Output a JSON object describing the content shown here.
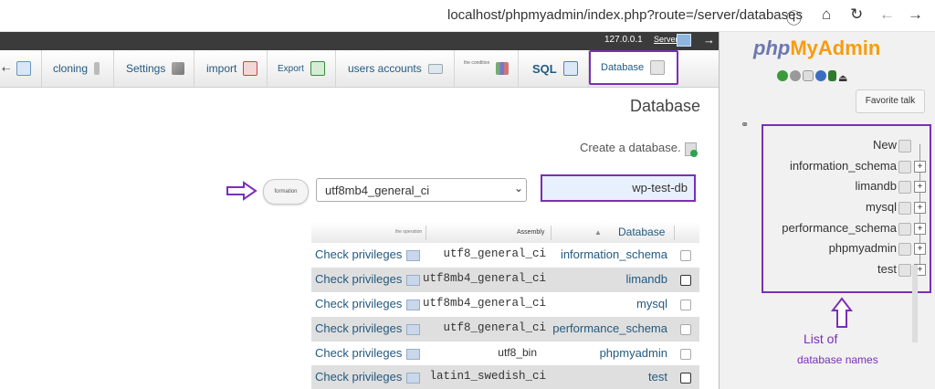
{
  "browser": {
    "url": "localhost/phpmyadmin/index.php?route=/server/databases"
  },
  "server": {
    "ip": "127.0.0.1",
    "label": "Server"
  },
  "tabs": [
    {
      "label": "",
      "name": "tab-fragment"
    },
    {
      "label": "cloning",
      "name": "tab-cloning"
    },
    {
      "label": "Settings",
      "name": "tab-settings"
    },
    {
      "label": "import",
      "name": "tab-import"
    },
    {
      "label": "Export",
      "name": "tab-export"
    },
    {
      "label": "users accounts",
      "name": "tab-users-accounts"
    },
    {
      "label": "the condition",
      "name": "tab-condition"
    },
    {
      "label": "SQL",
      "name": "tab-sql"
    },
    {
      "label": "Database",
      "name": "tab-database"
    }
  ],
  "page": {
    "title": "Database",
    "create_label": "Create a database.",
    "form_button": "formation",
    "collation_value": "utf8mb4_general_ci",
    "db_name_value": "wp-test-db"
  },
  "table": {
    "headers": {
      "operation": "the operation",
      "assembly": "Assembly",
      "database": "Database"
    },
    "rows": [
      {
        "action": "Check privileges",
        "collation": "utf8_general_ci",
        "database": "information_schema"
      },
      {
        "action": "Check privileges",
        "collation": "utf8mb4_general_ci",
        "database": "limandb"
      },
      {
        "action": "Check privileges",
        "collation": "utf8mb4_general_ci",
        "database": "mysql"
      },
      {
        "action": "Check privileges",
        "collation": "utf8_general_ci",
        "database": "performance_schema"
      },
      {
        "action": "Check privileges",
        "collation": "utf8_bin",
        "database": "phpmyadmin"
      },
      {
        "action": "Check privileges",
        "collation": "latin1_swedish_ci",
        "database": "test"
      }
    ]
  },
  "sidebar": {
    "logo_php": "php",
    "logo_myadmin": "MyAdmin",
    "favorite_label": "Favorite talk",
    "tree": [
      "New",
      "information_schema",
      "limandb",
      "mysql",
      "performance_schema",
      "phpmyadmin",
      "test"
    ]
  },
  "annotation": {
    "line1": "List of",
    "line2": "database names"
  },
  "colors": {
    "accent_purple": "#7a2fb5",
    "link_blue": "#235a81",
    "logo_blue": "#6c78af",
    "logo_orange": "#f89c0e"
  }
}
